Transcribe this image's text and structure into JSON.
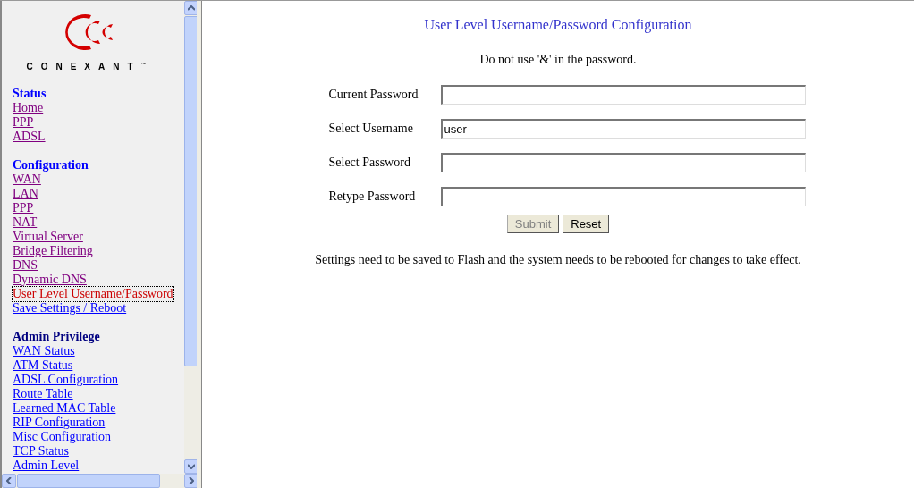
{
  "sidebar": {
    "logo_text": "CONEXANT",
    "logo_mark": "™",
    "sections": [
      {
        "title": "Status",
        "kind": "blue",
        "links": [
          {
            "label": "Home",
            "visited": true,
            "selected": false
          },
          {
            "label": "PPP",
            "visited": true,
            "selected": false
          },
          {
            "label": "ADSL",
            "visited": true,
            "selected": false
          }
        ]
      },
      {
        "title": "Configuration",
        "kind": "blue",
        "links": [
          {
            "label": "WAN",
            "visited": true,
            "selected": false
          },
          {
            "label": "LAN",
            "visited": true,
            "selected": false
          },
          {
            "label": "PPP",
            "visited": true,
            "selected": false
          },
          {
            "label": "NAT",
            "visited": true,
            "selected": false
          },
          {
            "label": "Virtual Server",
            "visited": true,
            "selected": false
          },
          {
            "label": "Bridge Filtering",
            "visited": true,
            "selected": false
          },
          {
            "label": "DNS",
            "visited": true,
            "selected": false
          },
          {
            "label": "Dynamic DNS",
            "visited": true,
            "selected": false
          },
          {
            "label": "User Level Username/Password",
            "visited": true,
            "selected": true
          },
          {
            "label": "Save Settings / Reboot",
            "visited": false,
            "selected": false
          }
        ]
      },
      {
        "title": "Admin Privilege",
        "kind": "navy",
        "links": [
          {
            "label": "WAN Status",
            "visited": false,
            "selected": false
          },
          {
            "label": "ATM Status",
            "visited": false,
            "selected": false
          },
          {
            "label": "ADSL Configuration",
            "visited": false,
            "selected": false
          },
          {
            "label": "Route Table",
            "visited": false,
            "selected": false
          },
          {
            "label": "Learned MAC Table",
            "visited": false,
            "selected": false
          },
          {
            "label": "RIP Configuration",
            "visited": false,
            "selected": false
          },
          {
            "label": "Misc Configuration",
            "visited": false,
            "selected": false
          },
          {
            "label": "TCP Status",
            "visited": false,
            "selected": false
          },
          {
            "label": "Admin Level",
            "visited": false,
            "selected": false
          }
        ]
      }
    ]
  },
  "main": {
    "title": "User Level Username/Password Configuration",
    "note": "Do not use '&' in the password.",
    "fields": [
      {
        "label": "Current Password"
      },
      {
        "label": "Select Username",
        "value": "user"
      },
      {
        "label": "Select Password"
      },
      {
        "label": "Retype Password"
      }
    ],
    "buttons": [
      {
        "label": "Submit",
        "disabled": true
      },
      {
        "label": "Reset",
        "disabled": false
      }
    ],
    "footer": "Settings need to be saved to Flash and the system needs to be rebooted for changes to take effect."
  }
}
